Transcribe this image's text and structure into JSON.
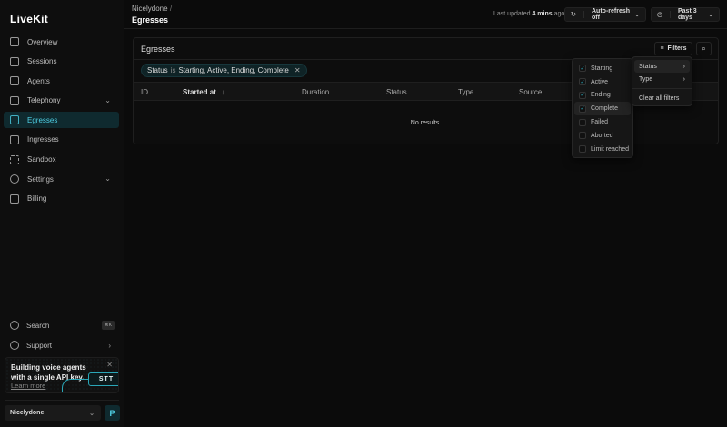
{
  "sidebar": {
    "logo": "LiveKit",
    "items": [
      {
        "label": "Overview",
        "icon": "chart-icon"
      },
      {
        "label": "Sessions",
        "icon": "grid-icon"
      },
      {
        "label": "Agents",
        "icon": "robot-icon"
      },
      {
        "label": "Telephony",
        "icon": "phone-icon",
        "expandable": true
      },
      {
        "label": "Egresses",
        "icon": "upload-icon",
        "active": true
      },
      {
        "label": "Ingresses",
        "icon": "download-icon"
      },
      {
        "label": "Sandbox",
        "icon": "sandbox-icon"
      },
      {
        "label": "Settings",
        "icon": "gear-icon",
        "expandable": true
      },
      {
        "label": "Billing",
        "icon": "card-icon"
      }
    ],
    "search": {
      "label": "Search",
      "shortcut": "⌘K"
    },
    "support": {
      "label": "Support"
    },
    "promo": {
      "text": "Building voice agents with a single API key.",
      "link": "Learn more",
      "badge": "STT"
    },
    "project": {
      "name": "Nicelydone",
      "avatar": "P"
    }
  },
  "header": {
    "breadcrumb": "Nicelydone",
    "separator": "/",
    "title": "Egresses",
    "updated_prefix": "Last updated",
    "updated_value": "4 mins",
    "updated_suffix": "ago",
    "refresh": "Auto-refresh off",
    "range": "Past 3 days"
  },
  "card": {
    "title": "Egresses",
    "filters_label": "Filters",
    "chip": {
      "field": "Status",
      "op": "is",
      "values": "Starting, Active, Ending, Complete"
    },
    "columns": [
      "ID",
      "Started at",
      "Duration",
      "Status",
      "Type",
      "Source"
    ],
    "empty": "No results."
  },
  "filter_menu": {
    "items": [
      "Status",
      "Type"
    ],
    "clear": "Clear all filters"
  },
  "status_options": [
    {
      "label": "Starting",
      "checked": true
    },
    {
      "label": "Active",
      "checked": true
    },
    {
      "label": "Ending",
      "checked": true
    },
    {
      "label": "Complete",
      "checked": true
    },
    {
      "label": "Failed",
      "checked": false
    },
    {
      "label": "Aborted",
      "checked": false
    },
    {
      "label": "Limit reached",
      "checked": false
    }
  ],
  "colors": {
    "accent": "#4fd1e6",
    "bg": "#0b0b0b"
  }
}
